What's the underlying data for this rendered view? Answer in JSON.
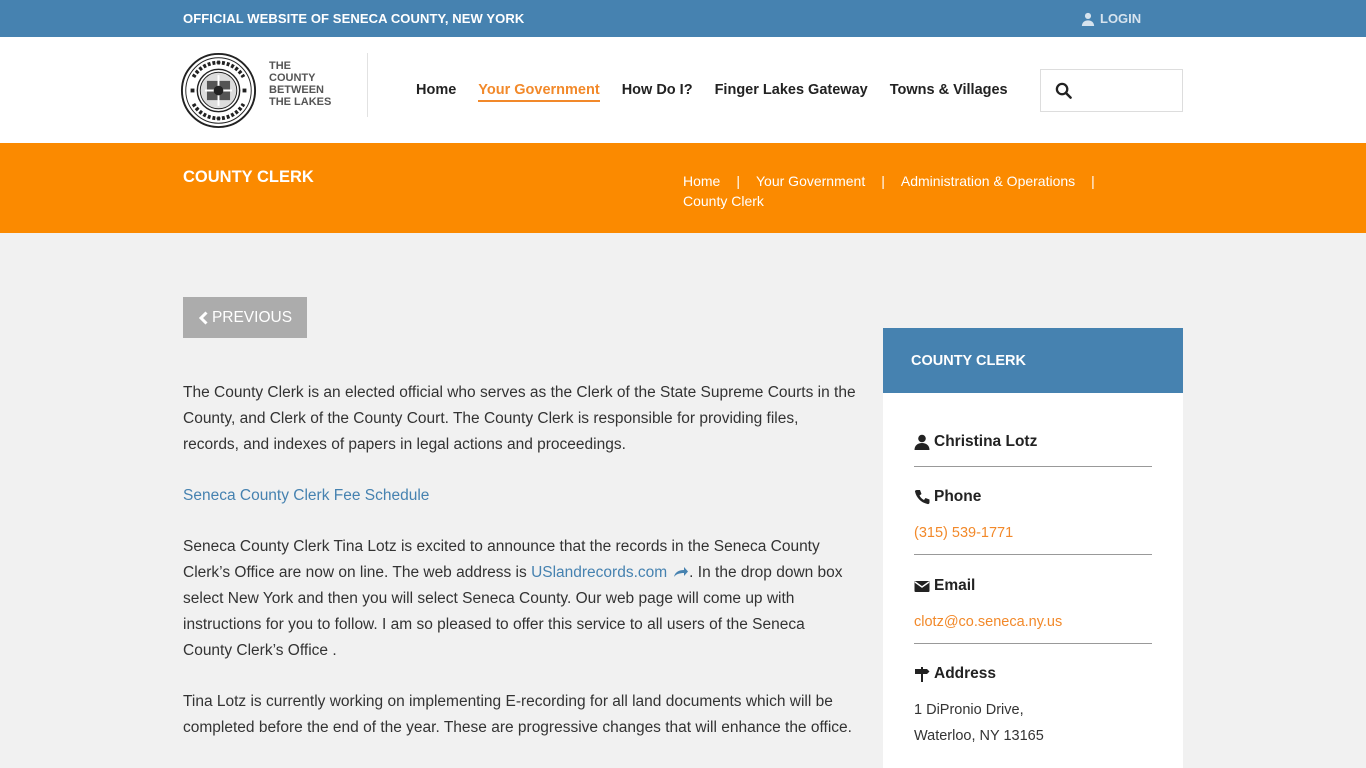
{
  "topbar": {
    "official": "OFFICIAL WEBSITE OF SENECA COUNTY, NEW YORK",
    "login": "LOGIN",
    "color": "#4682b0"
  },
  "header": {
    "tagline_lines": [
      "THE",
      "COUNTY",
      "BETWEEN",
      "THE LAKES"
    ],
    "nav": [
      "Home",
      "Your Government",
      "How Do I?",
      "Finger Lakes Gateway",
      "Towns & Villages"
    ],
    "active_nav": "Your Government",
    "search_placeholder": ""
  },
  "band": {
    "title": "COUNTY CLERK",
    "breadcrumbs": [
      "Home",
      "Your Government",
      "Administration & Operations",
      "County Clerk"
    ],
    "color": "#fb8a00"
  },
  "previous_label": "PREVIOUS",
  "main": {
    "p1": "The County Clerk is an elected official who serves as the Clerk of the State Supreme Courts in the County, and Clerk of the County Court. The County Clerk is responsible for providing files, records, and indexes of papers in legal actions and proceedings.",
    "fee_link": "Seneca County Clerk Fee Schedule",
    "p3_before": "Seneca County Clerk Tina Lotz is excited to announce that the records in the Seneca County Clerk’s Office are now on line. The web address is ",
    "p3_link": "USlandrecords.com",
    "p3_after": ". In the drop down box select New York and then you will select Seneca County. Our web page will come up with instructions for you to follow. I am so pleased to offer this service to all users of the Seneca County Clerk’s Office .",
    "p4": "Tina Lotz is currently working on implementing E-recording for all land documents which will be completed before the end of the year. These are progressive changes that will enhance the office."
  },
  "sidebar": {
    "title": "COUNTY CLERK",
    "name": "Christina Lotz",
    "phone_label": "Phone",
    "phone": "(315) 539-1771",
    "email_label": "Email",
    "email": "clotz@co.seneca.ny.us",
    "address_label": "Address",
    "address_line1": "1 DiPronio Drive,",
    "address_line2": "Waterloo, NY 13165"
  }
}
